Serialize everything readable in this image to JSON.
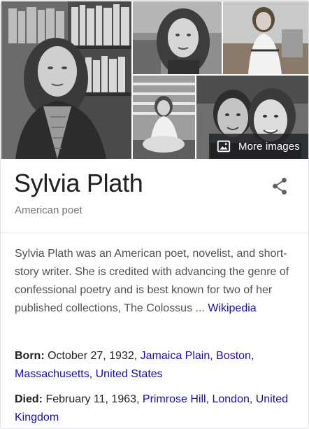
{
  "images": {
    "more_images_label": "More images",
    "items": [
      {
        "subject": "portrait-with-bookshelf"
      },
      {
        "subject": "portrait-outdoors"
      },
      {
        "subject": "portrait-seated"
      },
      {
        "subject": "portrait-sitting-porch"
      },
      {
        "subject": "couple-portrait"
      }
    ]
  },
  "header": {
    "title": "Sylvia Plath",
    "subtitle": "American poet",
    "share_icon": "share-icon"
  },
  "description": {
    "text": "Sylvia Plath was an American poet, novelist, and short-story writer. She is credited with advancing the genre of confessional poetry and is best known for two of her published collections, The Colossus ...",
    "source_label": "Wikipedia"
  },
  "facts": {
    "born": {
      "label": "Born:",
      "date": "October 27, 1932",
      "place_1": "Jamaica Plain",
      "place_2": "Boston",
      "place_3": "Massachusetts",
      "place_4": "United States"
    },
    "died": {
      "label": "Died:",
      "date": "February 11, 1963",
      "place_1": "Primrose Hill",
      "place_2": "London",
      "place_3": "United Kingdom"
    }
  },
  "colors": {
    "link": "#1a0dab",
    "title": "#202124",
    "muted": "#70757a",
    "body": "#4d5156"
  }
}
